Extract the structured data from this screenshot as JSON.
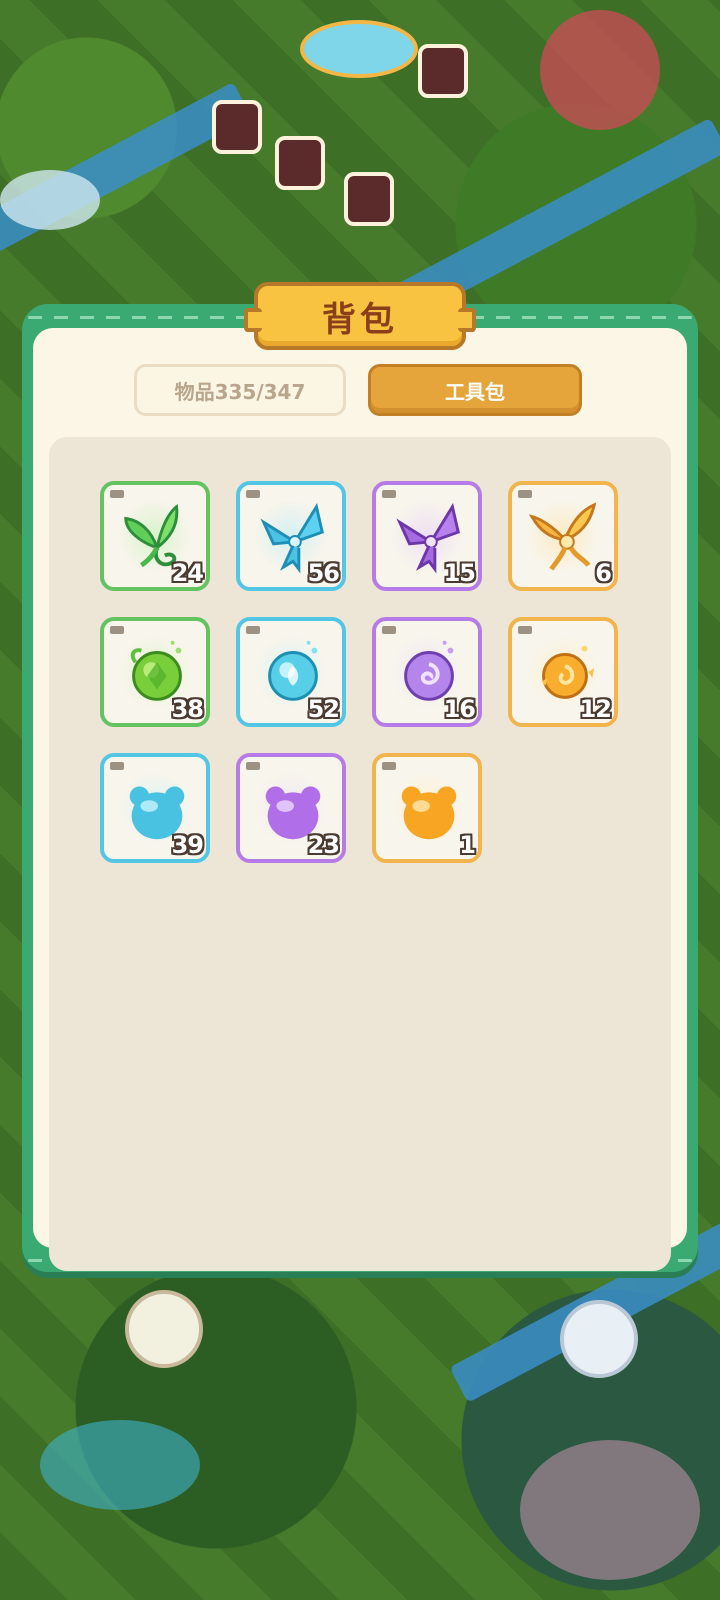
{
  "backpack": {
    "title": "背包",
    "tabs": [
      {
        "label": "物品335/347",
        "active": false
      },
      {
        "label": "工具包",
        "active": true
      }
    ],
    "items": [
      {
        "icon": "green-leaf-tool-icon",
        "rarity": "green",
        "count": "24"
      },
      {
        "icon": "blue-ribbon-tool-icon",
        "rarity": "blue",
        "count": "56"
      },
      {
        "icon": "purple-ribbon-tool-icon",
        "rarity": "purple",
        "count": "15"
      },
      {
        "icon": "golden-wing-tool-icon",
        "rarity": "orange",
        "count": "6"
      },
      {
        "icon": "green-seed-orb-icon",
        "rarity": "green",
        "count": "38"
      },
      {
        "icon": "blue-seed-orb-icon",
        "rarity": "blue",
        "count": "52"
      },
      {
        "icon": "purple-seed-orb-icon",
        "rarity": "purple",
        "count": "16"
      },
      {
        "icon": "golden-seed-orb-icon",
        "rarity": "orange",
        "count": "12"
      },
      {
        "icon": "blue-jelly-bear-icon",
        "rarity": "blue",
        "count": "39"
      },
      {
        "icon": "purple-jelly-bear-icon",
        "rarity": "purple",
        "count": "23"
      },
      {
        "icon": "orange-jelly-bear-icon",
        "rarity": "orange",
        "count": "1"
      }
    ]
  },
  "colors": {
    "green": "#63c35f",
    "blue": "#54c5e4",
    "purple": "#b67ce6",
    "orange": "#f1b44e",
    "frame": "#3aa972",
    "title_plate": "#f7c341"
  }
}
